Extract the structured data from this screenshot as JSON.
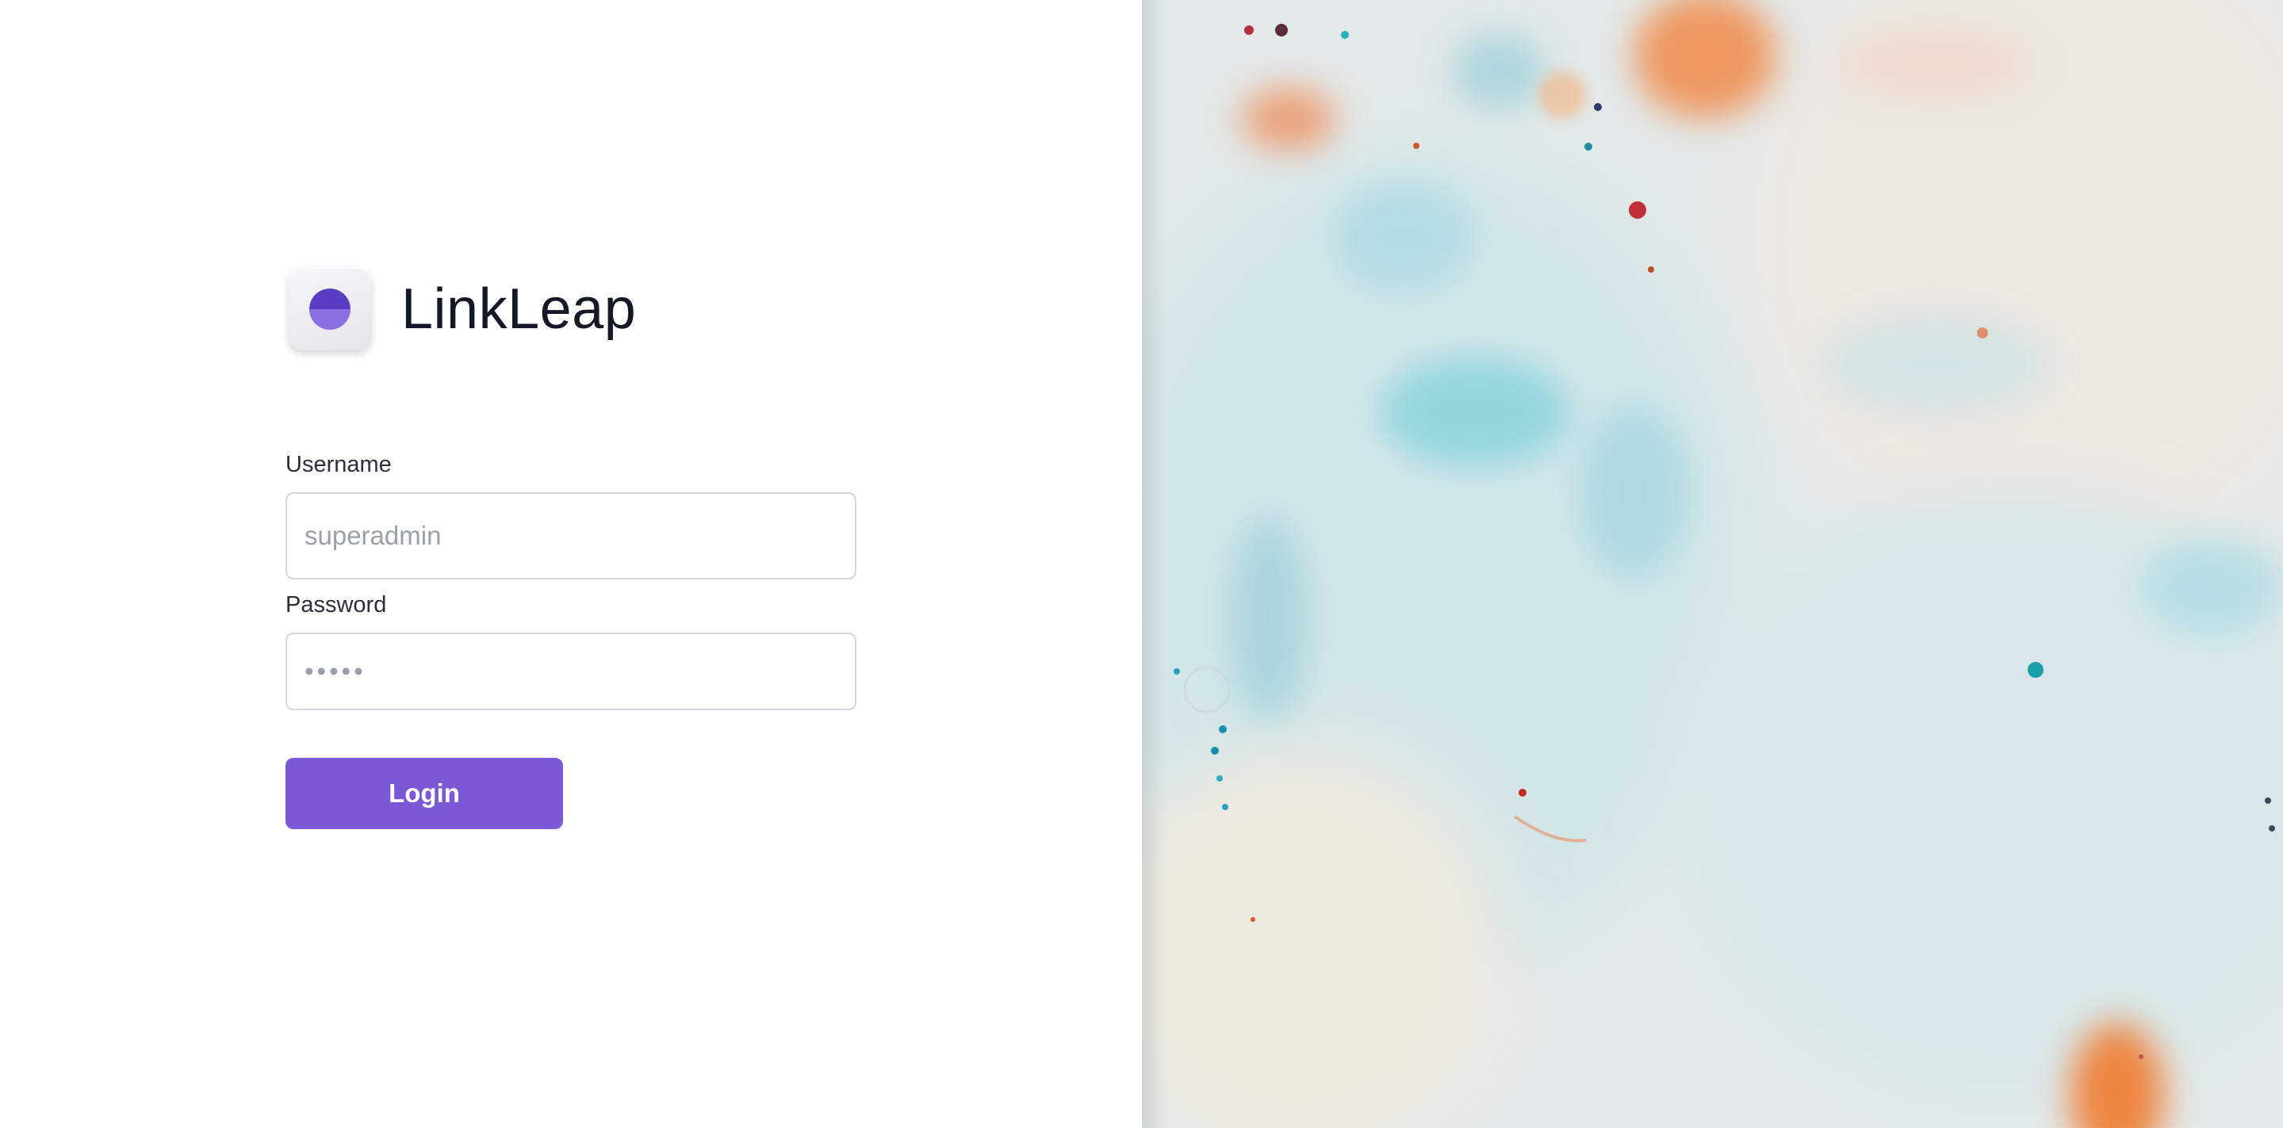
{
  "brand": {
    "name": "LinkLeap",
    "logo_icon": "half-circle-logo-icon",
    "accent_color": "#7a58d6"
  },
  "login_form": {
    "username": {
      "label": "Username",
      "placeholder": "superadmin",
      "value": ""
    },
    "password": {
      "label": "Password",
      "placeholder": "•••••",
      "value": ""
    },
    "submit_label": "Login"
  },
  "hero_image": {
    "description_icon": "marbled-ink-background-image"
  }
}
